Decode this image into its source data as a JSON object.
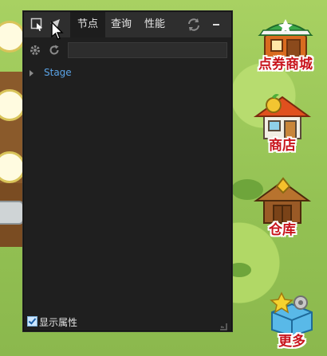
{
  "panel": {
    "tabs": [
      {
        "label": "节点",
        "active": true
      },
      {
        "label": "查询",
        "active": false
      },
      {
        "label": "性能",
        "active": false
      }
    ],
    "search": {
      "value": "",
      "placeholder": ""
    },
    "tree": [
      {
        "label": "Stage",
        "expanded": false
      }
    ],
    "show_props": {
      "label": "显示属性",
      "checked": true
    }
  },
  "game_buttons": [
    {
      "label": "点券商城",
      "icon": "shop-stall-icon"
    },
    {
      "label": "商店",
      "icon": "shop-house-icon"
    },
    {
      "label": "仓库",
      "icon": "warehouse-icon"
    },
    {
      "label": "更多",
      "icon": "more-box-icon"
    }
  ],
  "colors": {
    "panel_bg": "#1f1f1f",
    "tab_bar": "#2e2e2e",
    "node_text": "#5aa3e6",
    "game_label": "#c8141c"
  }
}
